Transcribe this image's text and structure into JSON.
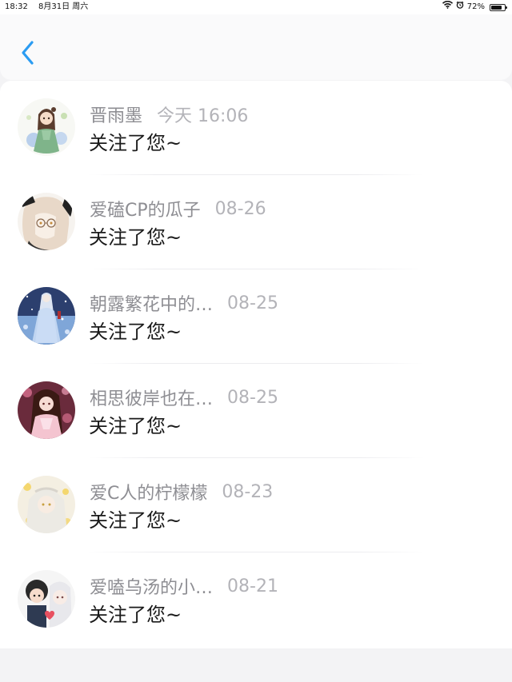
{
  "status_bar": {
    "time": "18:32",
    "date": "8月31日 周六",
    "battery_percent": "72%",
    "battery_level": 0.72,
    "icons": [
      "wifi-icon",
      "alarm-icon",
      "battery-icon"
    ]
  },
  "header": {
    "back_icon": "chevron-left-icon",
    "accent_color": "#2b9cf2"
  },
  "notifications": [
    {
      "name": "晋雨墨",
      "time": "今天 16:06",
      "message": "关注了您~"
    },
    {
      "name": "爱磕CP的瓜子",
      "time": "08-26",
      "message": "关注了您~"
    },
    {
      "name": "朝露繁花中的…",
      "time": "08-25",
      "message": "关注了您~"
    },
    {
      "name": "相思彼岸也在…",
      "time": "08-25",
      "message": "关注了您~"
    },
    {
      "name": "爱C人的柠檬檬",
      "time": "08-23",
      "message": "关注了您~"
    },
    {
      "name": "爱嗑乌汤的小…",
      "time": "08-21",
      "message": "关注了您~"
    }
  ]
}
